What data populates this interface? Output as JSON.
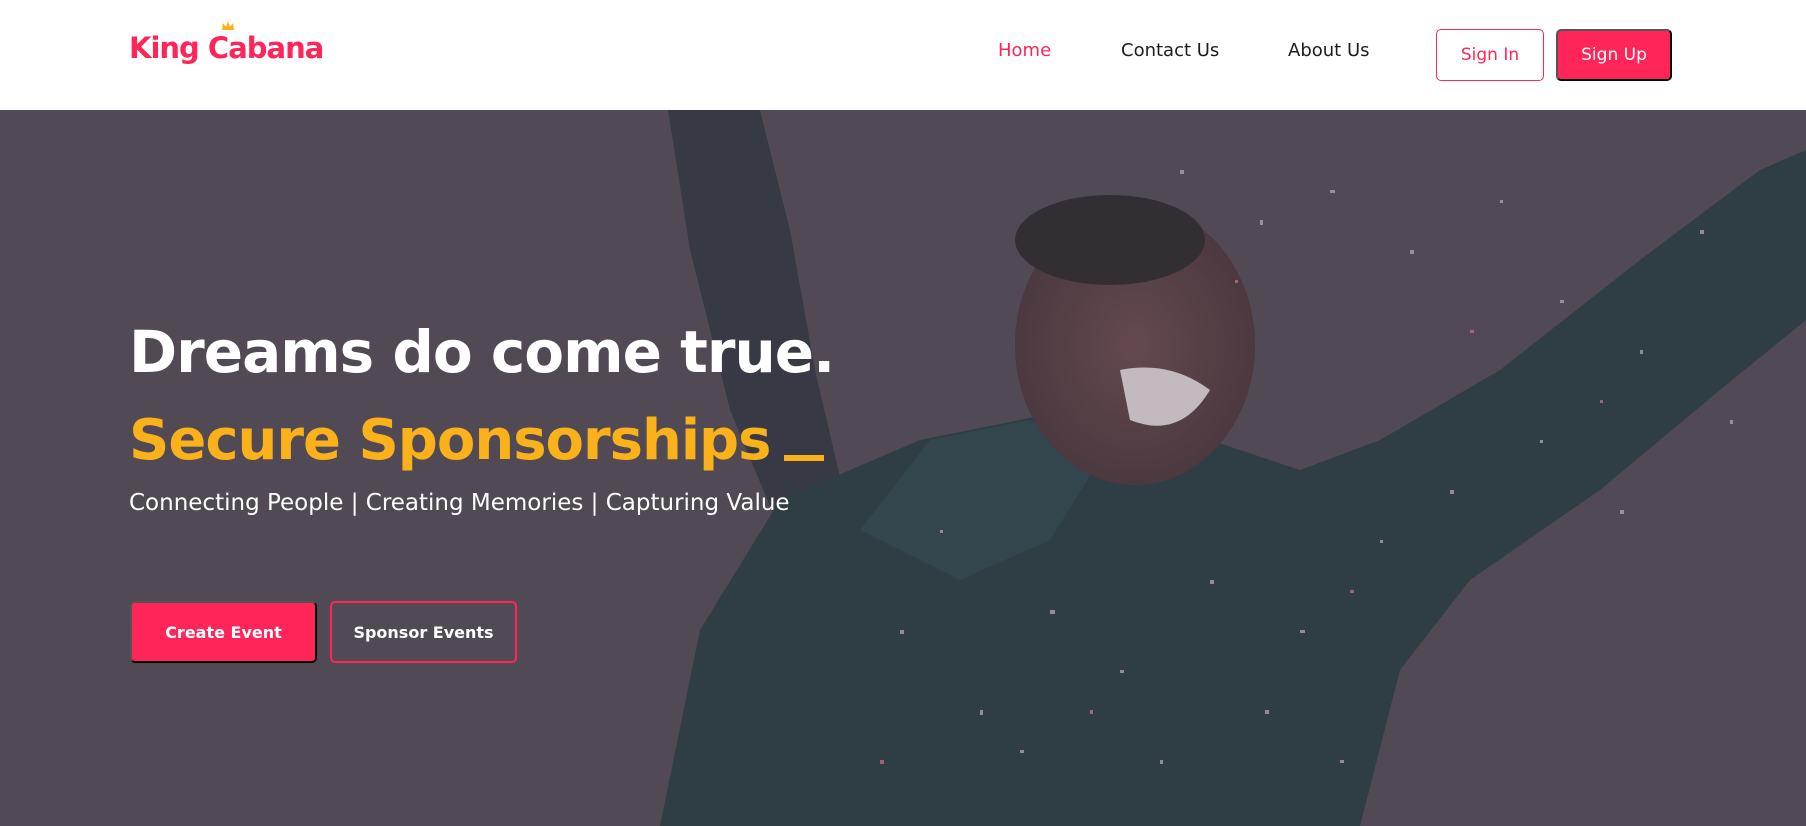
{
  "brand": {
    "name": "King Cabana",
    "accent_color": "#ff2559",
    "highlight_color": "#fbb21a",
    "logo_icon": "crown-icon"
  },
  "nav": {
    "items": [
      {
        "label": "Home",
        "active": true
      },
      {
        "label": "Contact Us",
        "active": false
      },
      {
        "label": "About Us",
        "active": false
      }
    ],
    "sign_in_label": "Sign In",
    "sign_up_label": "Sign Up"
  },
  "hero": {
    "title": "Dreams do come true.",
    "subtitle": "Secure Sponsorships",
    "tagline": "Connecting People | Creating Memories | Capturing Value",
    "primary_button_label": "Create Event",
    "secondary_button_label": "Sponsor Events",
    "background_image": "celebrating-woman-confetti-photo"
  }
}
